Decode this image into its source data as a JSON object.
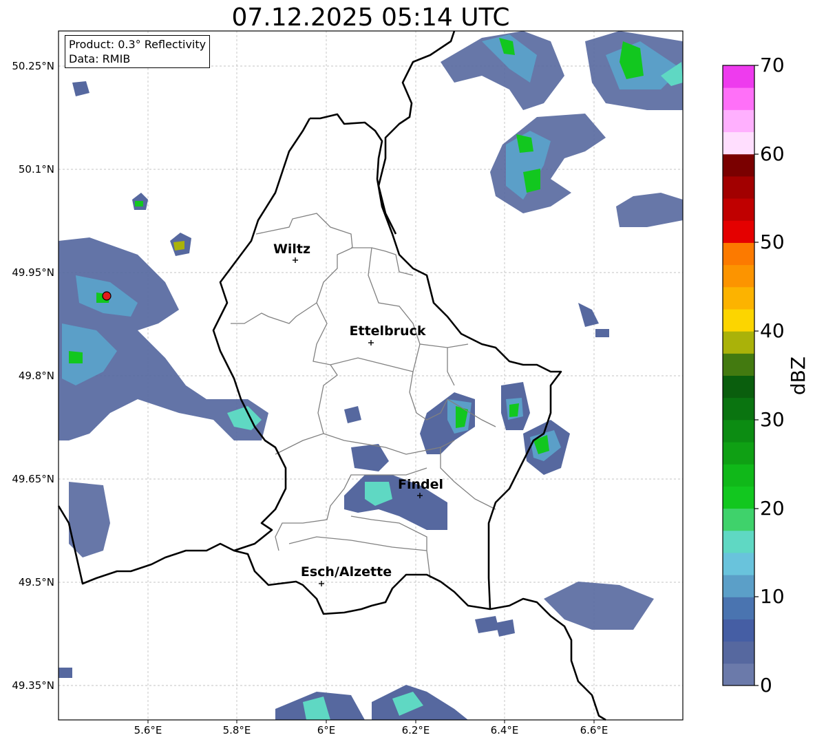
{
  "title": "07.12.2025 05:14 UTC",
  "info_box": {
    "product": "Product: 0.3° Reflectivity",
    "data": "Data: RMIB"
  },
  "axes": {
    "lon_ticks": [
      "5.6°E",
      "5.8°E",
      "6°E",
      "6.2°E",
      "6.4°E",
      "6.6°E"
    ],
    "lat_ticks": [
      "50.25°N",
      "50.1°N",
      "49.95°N",
      "49.8°N",
      "49.65°N",
      "49.5°N",
      "49.35°N"
    ]
  },
  "cities": [
    {
      "name": "Wiltz"
    },
    {
      "name": "Ettelbruck"
    },
    {
      "name": "Findel"
    },
    {
      "name": "Esch/Alzette"
    }
  ],
  "colorbar": {
    "label": "dBZ",
    "tick_labels": [
      "0",
      "10",
      "20",
      "30",
      "40",
      "50",
      "60",
      "70"
    ],
    "colors": [
      "#6b7aaa",
      "#56689f",
      "#455ea4",
      "#4a74b0",
      "#5b9fc8",
      "#69c3dc",
      "#5fd8c3",
      "#3fd26b",
      "#12c71f",
      "#10b819",
      "#0fa014",
      "#0c8c12",
      "#0a7410",
      "#0a5e0d",
      "#437a10",
      "#aab209",
      "#fcd500",
      "#fcb300",
      "#fc9400",
      "#fc7a00",
      "#e40000",
      "#c00000",
      "#a20000",
      "#7a0000",
      "#ffdefe",
      "#ffb0fe",
      "#ff70f8",
      "#ee3bee"
    ]
  },
  "colors": {
    "national_border": "#000000",
    "district_border": "#808080",
    "station_marker": "#e31a1c"
  }
}
